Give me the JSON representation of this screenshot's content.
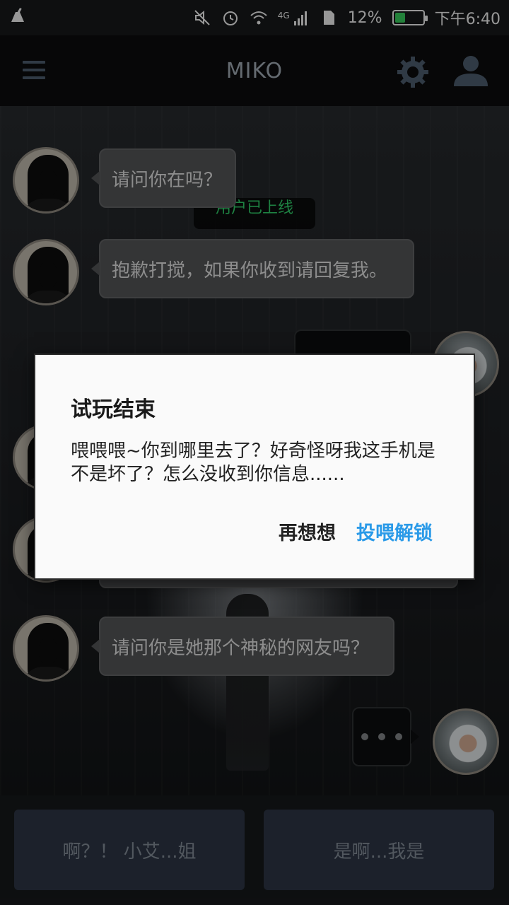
{
  "status_bar": {
    "battery_percent_text": "12%",
    "battery_level": 0.12,
    "time": "下午6:40",
    "network": "4G",
    "icons": [
      "cleaner-icon",
      "mute-icon",
      "alarm-icon",
      "wifi-icon",
      "signal-icon",
      "sim-icon",
      "battery-icon"
    ]
  },
  "app_bar": {
    "title": "MIKO",
    "menu_icon": "hamburger-menu-icon",
    "settings_icon": "gear-icon",
    "profile_icon": "person-icon"
  },
  "chat": {
    "system_notice": "用户已上线",
    "messages": [
      {
        "from": "contact",
        "text": "请问你在吗？"
      },
      {
        "from": "contact",
        "text": "抱歉打搅，如果你收到请回复我。"
      },
      {
        "from": "user",
        "text": ""
      },
      {
        "from": "contact",
        "text": ""
      },
      {
        "from": "contact",
        "text": ""
      },
      {
        "from": "contact",
        "text": "请问你是她那个神秘的网友吗？"
      },
      {
        "from": "user",
        "typing": true
      }
    ]
  },
  "options": [
    {
      "label": "啊？！ 小艾...姐"
    },
    {
      "label": "是啊...我是"
    }
  ],
  "dialog": {
    "title": "试玩结束",
    "message": "喂喂喂~你到哪里去了？好奇怪呀我这手机是不是坏了？怎么没收到你信息......",
    "cancel_label": "再想想",
    "confirm_label": "投喂解锁",
    "confirm_color": "#2a9ae8"
  },
  "colors": {
    "system_notice": "#2ec866",
    "option_button": "#2b3442"
  }
}
